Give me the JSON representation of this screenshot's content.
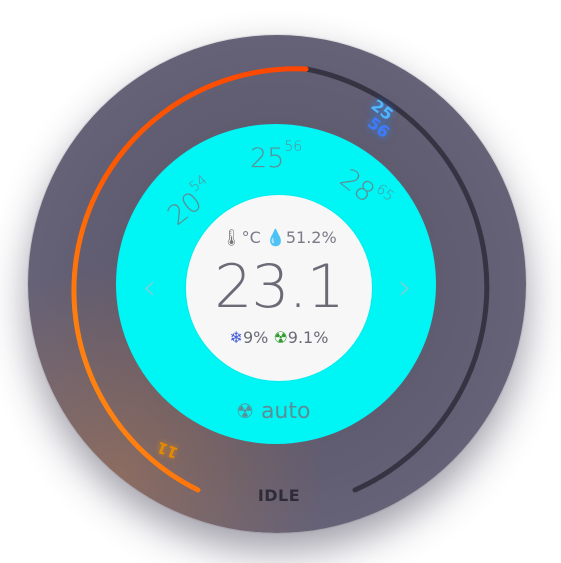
{
  "thermostat": {
    "current_temp": "23.1",
    "unit": "°C",
    "humidity": "51.2%",
    "stats": {
      "snow_value": "9%",
      "radiation_value": "9.1%"
    },
    "presets": [
      {
        "main": "20",
        "sup": "54"
      },
      {
        "main": "25",
        "sup": "56"
      },
      {
        "main": "28",
        "sup": "65"
      }
    ],
    "mode_label": "auto",
    "status": "IDLE",
    "high_marker": {
      "a": "25",
      "b": "56"
    },
    "low_marker": "11",
    "chevron_left": "‹",
    "chevron_right": "›"
  },
  "icons": {
    "thermometer": "🌡",
    "drop": "💧",
    "snowflake": "❄",
    "radiation": "☢"
  },
  "colors": {
    "ring_background": "#615d72",
    "arc_warm_start": "#ff4a00",
    "arc_warm_end": "#ff9a1a",
    "arc_track": "#3a3748",
    "cyan_disc": "#00f5f5",
    "inner_disc": "#f7f7f7",
    "high_marker": "#4fb7ff",
    "low_marker": "#e68a00"
  }
}
